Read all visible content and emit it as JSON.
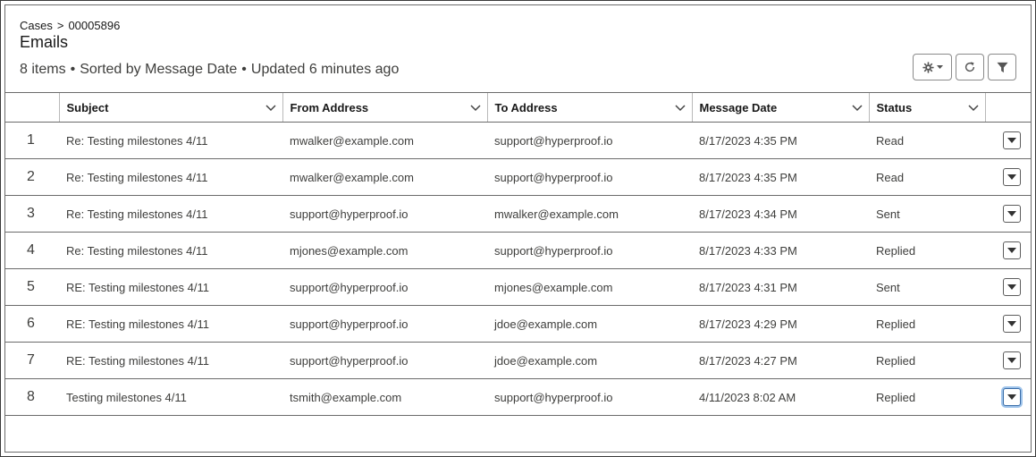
{
  "breadcrumb": {
    "parent": "Cases",
    "separator": ">",
    "current": "00005896"
  },
  "page_title": "Emails",
  "meta": {
    "items": "8 items",
    "sorted": "Sorted by Message Date",
    "updated": "Updated 6 minutes ago",
    "separator": "•"
  },
  "toolbar": {
    "settings_icon": "gear-icon",
    "refresh_icon": "refresh-icon",
    "filter_icon": "filter-icon"
  },
  "table": {
    "columns": [
      "Subject",
      "From Address",
      "To Address",
      "Message Date",
      "Status"
    ],
    "rows": [
      {
        "num": "1",
        "subject": "Re: Testing milestones 4/11",
        "from": "mwalker@example.com",
        "to": "support@hyperproof.io",
        "date": "8/17/2023 4:35 PM",
        "status": "Read"
      },
      {
        "num": "2",
        "subject": "Re: Testing milestones 4/11",
        "from": "mwalker@example.com",
        "to": "support@hyperproof.io",
        "date": "8/17/2023 4:35 PM",
        "status": "Read"
      },
      {
        "num": "3",
        "subject": "Re: Testing milestones 4/11",
        "from": "support@hyperproof.io",
        "to": "mwalker@example.com",
        "date": "8/17/2023 4:34 PM",
        "status": "Sent"
      },
      {
        "num": "4",
        "subject": "Re: Testing milestones 4/11",
        "from": "mjones@example.com",
        "to": "support@hyperproof.io",
        "date": "8/17/2023 4:33 PM",
        "status": "Replied"
      },
      {
        "num": "5",
        "subject": "RE: Testing milestones 4/11",
        "from": "support@hyperproof.io",
        "to": "mjones@example.com",
        "date": "8/17/2023 4:31 PM",
        "status": "Sent"
      },
      {
        "num": "6",
        "subject": "RE: Testing milestones 4/11",
        "from": "support@hyperproof.io",
        "to": "jdoe@example.com",
        "date": "8/17/2023 4:29 PM",
        "status": "Replied"
      },
      {
        "num": "7",
        "subject": "RE: Testing milestones 4/11",
        "from": "support@hyperproof.io",
        "to": "jdoe@example.com",
        "date": "8/17/2023 4:27 PM",
        "status": "Replied"
      },
      {
        "num": "8",
        "subject": "Testing milestones 4/11",
        "from": "tsmith@example.com",
        "to": "support@hyperproof.io",
        "date": "4/11/2023 8:02 AM",
        "status": "Replied"
      }
    ]
  }
}
